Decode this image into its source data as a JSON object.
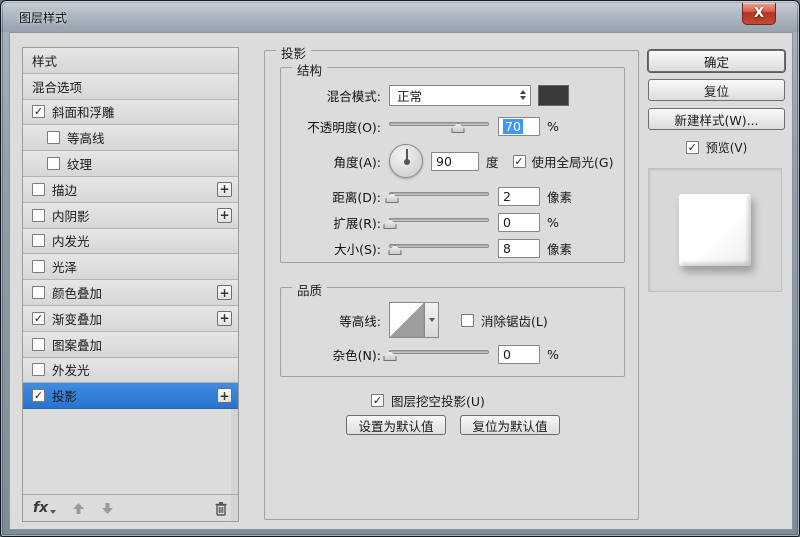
{
  "window": {
    "title": "图层样式",
    "close_glyph": "X"
  },
  "sidebar": {
    "items": [
      {
        "label": "样式"
      },
      {
        "label": "混合选项"
      },
      {
        "label": "斜面和浮雕",
        "check": "✓"
      },
      {
        "label": "等高线",
        "check": ""
      },
      {
        "label": "纹理",
        "check": ""
      },
      {
        "label": "描边",
        "check": "",
        "plus": "+"
      },
      {
        "label": "内阴影",
        "check": "",
        "plus": "+"
      },
      {
        "label": "内发光",
        "check": ""
      },
      {
        "label": "光泽",
        "check": ""
      },
      {
        "label": "颜色叠加",
        "check": "",
        "plus": "+"
      },
      {
        "label": "渐变叠加",
        "check": "✓",
        "plus": "+"
      },
      {
        "label": "图案叠加",
        "check": ""
      },
      {
        "label": "外发光",
        "check": ""
      },
      {
        "label": "投影",
        "check": "✓",
        "plus": "+"
      }
    ],
    "selected_item": "投影",
    "footer": {
      "fx_label": "fx"
    }
  },
  "main": {
    "title": "投影",
    "structure": {
      "title": "结构",
      "blend_mode": {
        "label": "混合模式:",
        "value": "正常",
        "swatch_color": "#3a3a3a"
      },
      "opacity": {
        "label": "不透明度(O):",
        "value": "70",
        "unit": "%",
        "thumb_pct": 69
      },
      "angle": {
        "label": "角度(A):",
        "value": "90",
        "unit": "度",
        "degrees": 90,
        "global_label": "使用全局光(G)",
        "global_checked": "✓"
      },
      "distance": {
        "label": "距离(D):",
        "value": "2",
        "unit": "像素",
        "thumb_pct": 3
      },
      "spread": {
        "label": "扩展(R):",
        "value": "0",
        "unit": "%",
        "thumb_pct": 1
      },
      "size": {
        "label": "大小(S):",
        "value": "8",
        "unit": "像素",
        "thumb_pct": 6
      }
    },
    "quality": {
      "title": "品质",
      "contour_label": "等高线:",
      "antialias": {
        "label": "消除锯齿(L)",
        "checked": ""
      },
      "noise": {
        "label": "杂色(N):",
        "value": "0",
        "unit": "%",
        "thumb_pct": 1
      }
    },
    "knockout": {
      "label": "图层挖空投影(U)",
      "checked": "✓"
    },
    "default_buttons": {
      "set_default": "设置为默认值",
      "reset_default": "复位为默认值"
    }
  },
  "actions": {
    "ok": "确定",
    "reset": "复位",
    "new_style": "新建样式(W)...",
    "preview": {
      "label": "预览(V)",
      "checked": "✓"
    }
  },
  "colors": {
    "selected_row_blue": "#2f7cd6",
    "swatch_dark": "#3a3a3a",
    "close_button_red": "#c0392b",
    "dialog_bg": "#dcdcdc"
  }
}
